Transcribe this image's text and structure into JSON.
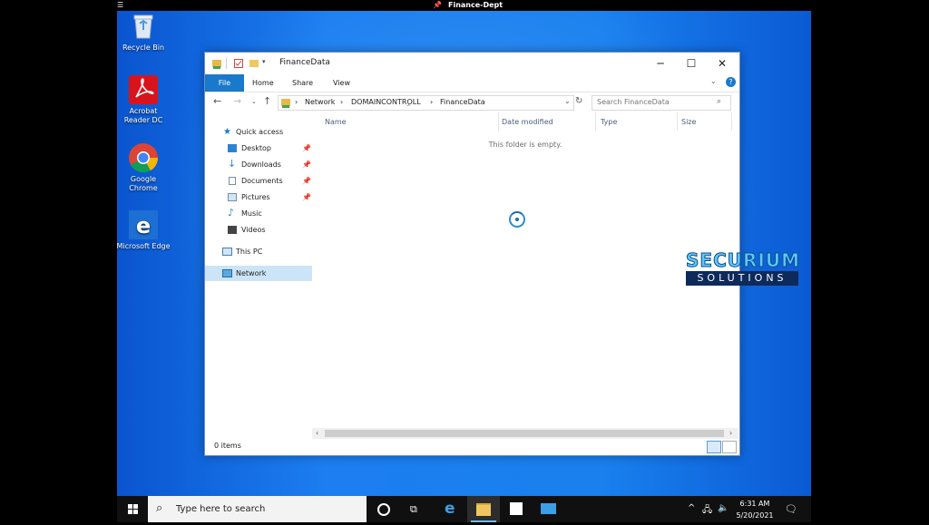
{
  "session": {
    "title": "Finance-Dept"
  },
  "desktop": {
    "icons": [
      {
        "label": "Recycle Bin"
      },
      {
        "label": "Acrobat Reader DC"
      },
      {
        "label": "Google Chrome"
      },
      {
        "label": "Microsoft Edge"
      }
    ]
  },
  "explorer": {
    "title": "FinanceData",
    "ribbon": {
      "tabs": [
        "File",
        "Home",
        "Share",
        "View"
      ]
    },
    "address": {
      "segments": [
        "Network",
        "DOMAINCONTROLL",
        "FinanceData"
      ]
    },
    "search": {
      "placeholder": "Search FinanceData"
    },
    "nav": {
      "quick_access": "Quick access",
      "items": [
        "Desktop",
        "Downloads",
        "Documents",
        "Pictures",
        "Music",
        "Videos"
      ],
      "this_pc": "This PC",
      "network": "Network"
    },
    "columns": [
      "Name",
      "Date modified",
      "Type",
      "Size"
    ],
    "empty_message": "This folder is empty.",
    "status": "0 items"
  },
  "watermark": {
    "top": "SECURIUM",
    "bottom": "SOLUTIONS"
  },
  "taskbar": {
    "search_placeholder": "Type here to search",
    "time": "6:31 AM",
    "date": "5/20/2021"
  },
  "colors": {
    "accent": "#1979ca",
    "selection": "#cce4f7",
    "desktop": "#1980ee"
  }
}
